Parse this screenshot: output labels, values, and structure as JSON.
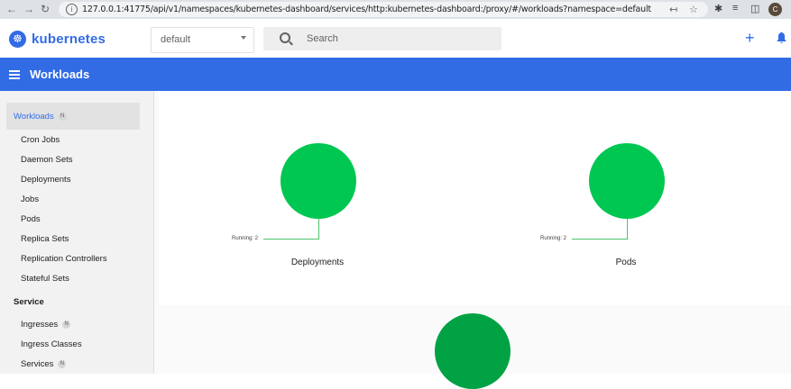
{
  "browser": {
    "url": "127.0.0.1:41775/api/v1/namespaces/kubernetes-dashboard/services/http:kubernetes-dashboard:/proxy/#/workloads?namespace=default",
    "profile_initial": "C"
  },
  "toolbar": {
    "logo_text": "kubernetes",
    "namespace_value": "default",
    "search_placeholder": "Search"
  },
  "appbar": {
    "title": "Workloads"
  },
  "sidebar": {
    "active": {
      "label": "Workloads",
      "badge": "N"
    },
    "items": [
      {
        "label": "Cron Jobs"
      },
      {
        "label": "Daemon Sets"
      },
      {
        "label": "Deployments"
      },
      {
        "label": "Jobs"
      },
      {
        "label": "Pods"
      },
      {
        "label": "Replica Sets"
      },
      {
        "label": "Replication Controllers"
      },
      {
        "label": "Stateful Sets"
      }
    ],
    "service_section": "Service",
    "service_items": [
      {
        "label": "Ingresses",
        "badge": "N"
      },
      {
        "label": "Ingress Classes"
      },
      {
        "label": "Services",
        "badge": "N"
      }
    ]
  },
  "workload_status": {
    "deployments": {
      "title": "Deployments",
      "legend": "Running: 2",
      "running": 2
    },
    "pods": {
      "title": "Pods",
      "legend": "Running: 2",
      "running": 2
    }
  },
  "colors": {
    "brand": "#326ce5",
    "running": "#00c752",
    "running_dark": "#00a244"
  }
}
